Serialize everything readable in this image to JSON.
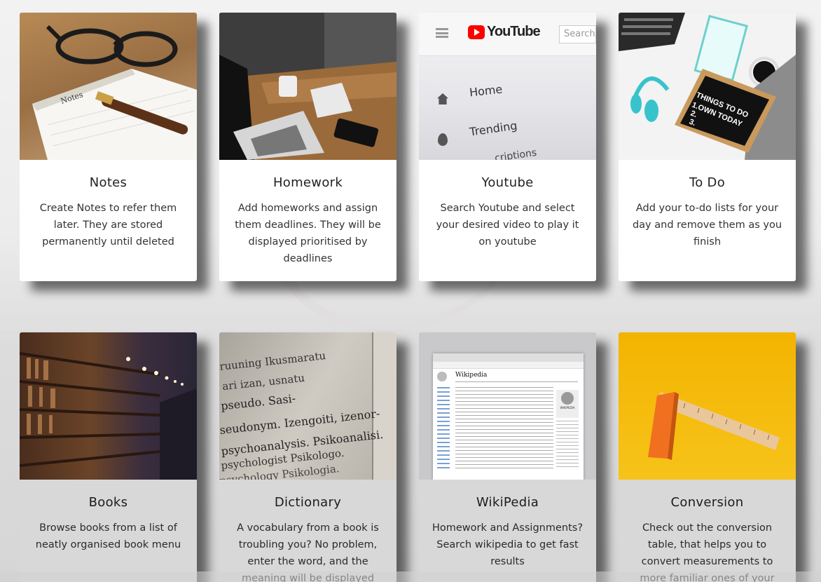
{
  "cards": [
    {
      "title": "Notes",
      "desc": "Create Notes to refer them later. They are stored permanently until deleted",
      "image": "notebook-with-pen-and-glasses"
    },
    {
      "title": "Homework",
      "desc": "Add homeworks and assign them deadlines. They will be displayed prioritised by deadlines",
      "image": "laptop-on-desk"
    },
    {
      "title": "Youtube",
      "desc": "Search Youtube and select your desired video to play it on youtube",
      "image": "youtube-app-screen",
      "screen": {
        "brand": "YouTube",
        "search": "Search",
        "menu1": "Home",
        "menu2": "Trending",
        "menu3": "criptions"
      }
    },
    {
      "title": "To Do",
      "desc": "Add your to-do lists for your day and remove them as you finish",
      "image": "things-to-do-board",
      "board": {
        "line1": "THINGS TO DO",
        "line2": "1.OWN TODAY",
        "line3": "2.",
        "line4": "3."
      }
    },
    {
      "title": "Books",
      "desc": "Browse books from a list of neatly organised book menu",
      "image": "library-bookshelves"
    },
    {
      "title": "Dictionary",
      "desc": "A vocabulary from a book is troubling you? No problem, enter the word, and the meaning will be displayed",
      "image": "dictionary-page",
      "words": [
        "ruuning  Ikusmaratu",
        "ari izan, usnatu",
        "pseudo. Sasi-",
        "seudonym. Izengoiti, izenor-",
        "psychoanalysis. Psikoanalisi.",
        "psychologist  Psikologo.",
        "psychology  Psikologia."
      ]
    },
    {
      "title": "WikiPedia",
      "desc": "Homework and Assignments? Search wikipedia to get fast results",
      "image": "wikipedia-screenshot",
      "wiki": {
        "heading": "Wikipedia",
        "logo_text": "WIKIPEDIA"
      }
    },
    {
      "title": "Conversion",
      "desc": "Check out the conversion table, that helps you to convert measurements to more familiar ones of your choice.",
      "image": "ruler-on-yellow"
    }
  ],
  "colors": {
    "background": "#ececec",
    "card": "#ffffff",
    "card_dim": "#d8d8d8",
    "youtube_red": "#ff0000",
    "yellow": "#f2b705"
  }
}
